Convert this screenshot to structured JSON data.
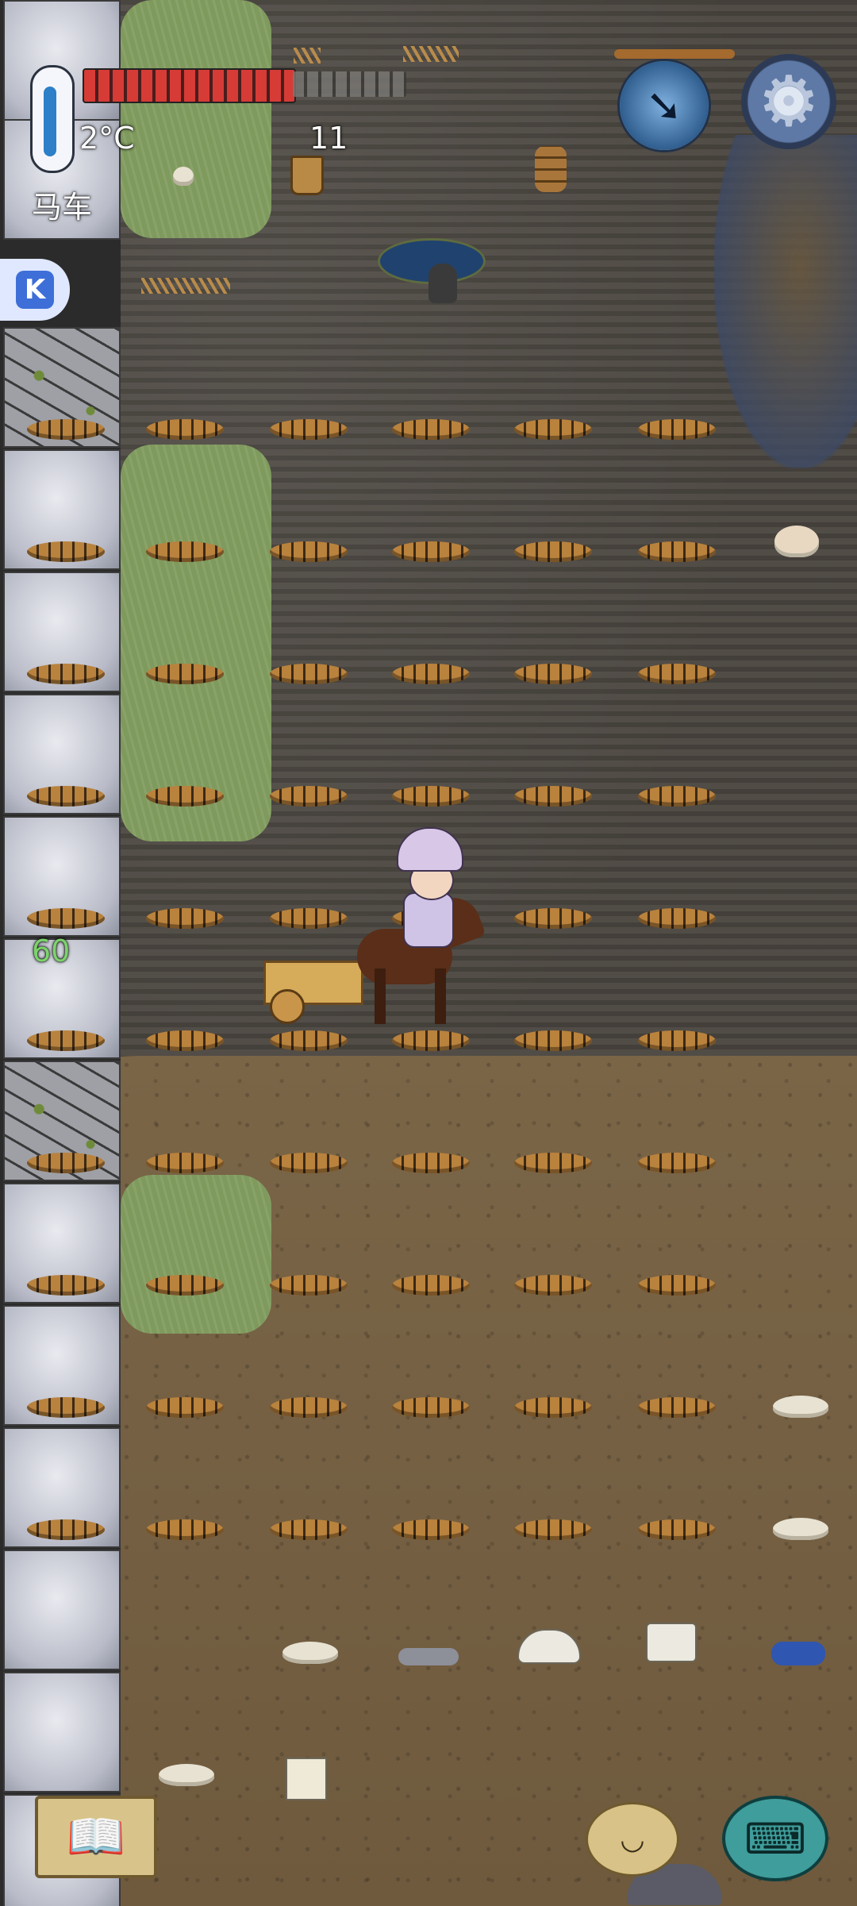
{
  "hud": {
    "temperature": "2°C",
    "held_item": "马车",
    "item_count": "11",
    "fps": "60",
    "food_meter": 0.65,
    "side_app_badge": "K"
  },
  "icons": {
    "thermometer": "thermometer-icon",
    "compass": "compass-icon",
    "settings": "gear-icon",
    "book": "book-icon",
    "keyboard": "keyboard-icon",
    "emote": "potato-face-icon"
  },
  "colors": {
    "food_fill": "#d73b36",
    "food_empty": "#7a7874",
    "fps_text": "#7bd46a"
  }
}
